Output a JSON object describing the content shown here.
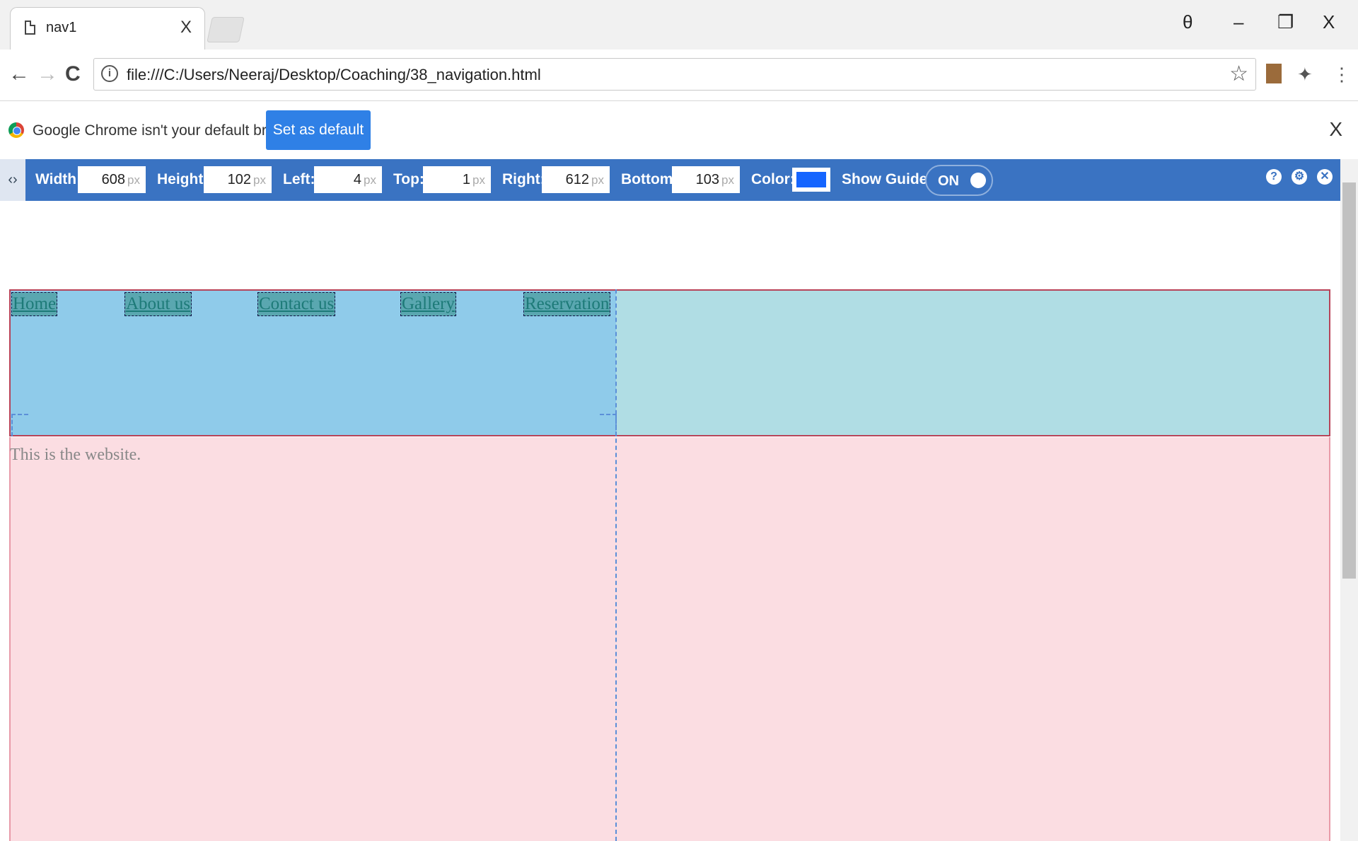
{
  "tab": {
    "title": "nav1",
    "close": "X"
  },
  "window_controls": {
    "profile": "θ",
    "minimize": "–",
    "restore": "❐",
    "close": "X"
  },
  "toolbar": {
    "back": "←",
    "forward": "→",
    "reload": "C",
    "url": "file:///C:/Users/Neeraj/Desktop/Coaching/38_navigation.html",
    "info": "i",
    "star": "☆"
  },
  "infobar": {
    "message": "Google Chrome isn't your default browser.",
    "button": "Set as default",
    "close": "X"
  },
  "ruler": {
    "handle": "‹›",
    "width_label": "Width:",
    "width_value": "608",
    "height_label": "Height:",
    "height_value": "102",
    "left_label": "Left:",
    "left_value": "4",
    "top_label": "Top:",
    "top_value": "1",
    "right_label": "Right:",
    "right_value": "612",
    "bottom_label": "Bottom:",
    "bottom_value": "103",
    "unit": "px",
    "color_label": "Color:",
    "color_value": "#1565ff",
    "guides_label": "Show Guides:",
    "guides_state": "ON",
    "help": "?",
    "settings": "⚙",
    "close": "✕"
  },
  "page": {
    "nav_links": [
      "Home",
      "About us",
      "Contact us",
      "Gallery",
      "Reservation"
    ],
    "body_text": "This is the website."
  }
}
